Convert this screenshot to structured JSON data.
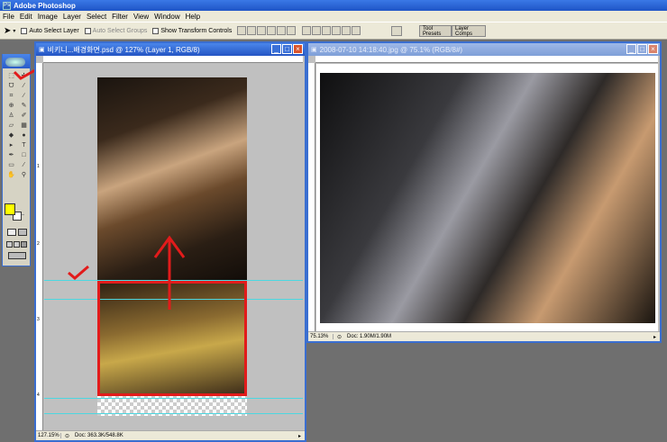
{
  "app": {
    "title": "Adobe Photoshop"
  },
  "menu": [
    "File",
    "Edit",
    "Image",
    "Layer",
    "Select",
    "Filter",
    "View",
    "Window",
    "Help"
  ],
  "options": {
    "auto_select_layer": "Auto Select Layer",
    "auto_select_groups": "Auto Select Groups",
    "show_transform_controls": "Show Transform Controls"
  },
  "panel_tabs": {
    "tool_presets": "Tool Presets",
    "layer_comps": "Layer Comps"
  },
  "colors": {
    "foreground": "#ffff00",
    "background": "#ffffff",
    "annotation": "#e21b1b",
    "guide": "#4cd7e0"
  },
  "doc1": {
    "title": "비키니...배경화면.psd @ 127% (Layer 1, RGB/8)",
    "zoom": "127.15%",
    "info": "Doc: 363.3K/548.8K",
    "ruler_marks": [
      "1",
      "2",
      "3",
      "4"
    ]
  },
  "doc2": {
    "title": "2008-07-10 14:18:40.jpg @ 75.1% (RGB/8#)",
    "zoom": "75.13%",
    "info": "Doc: 1.90M/1.90M"
  }
}
